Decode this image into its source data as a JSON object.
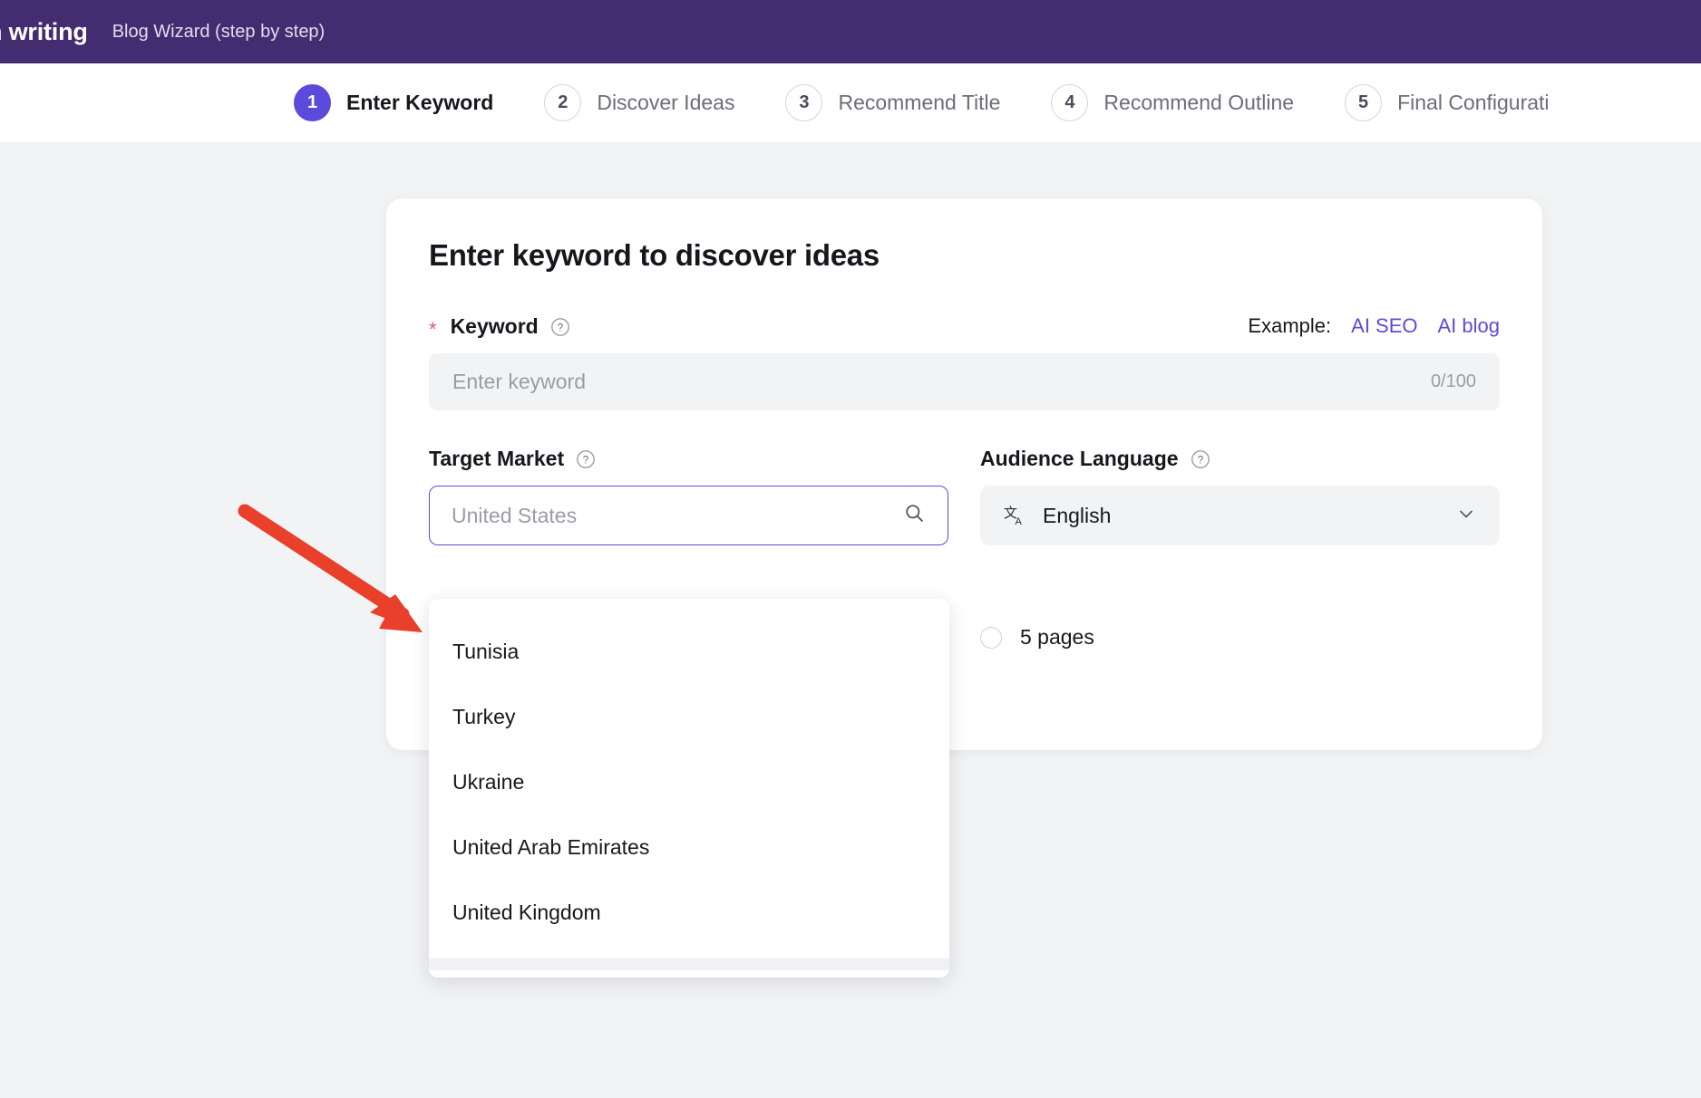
{
  "appbar": {
    "brand": "n writing",
    "subtitle": "Blog Wizard (step by step)",
    "bg_color": "#432c70"
  },
  "stepper": {
    "active_index": 0,
    "active_color": "#5b4bdd",
    "steps": [
      {
        "num": "1",
        "label": "Enter Keyword"
      },
      {
        "num": "2",
        "label": "Discover Ideas"
      },
      {
        "num": "3",
        "label": "Recommend Title"
      },
      {
        "num": "4",
        "label": "Recommend Outline"
      },
      {
        "num": "5",
        "label": "Final Configurati"
      }
    ]
  },
  "card": {
    "title": "Enter keyword to discover ideas",
    "keyword": {
      "label": "Keyword",
      "required_mark": "*",
      "help_icon": "question-circle-icon",
      "example_label": "Example:",
      "example_links": [
        "AI SEO",
        "AI blog"
      ],
      "placeholder": "Enter keyword",
      "value": "",
      "counter": "0/100",
      "link_color": "#5b4bdd"
    },
    "target_market": {
      "label": "Target Market",
      "help_icon": "question-circle-icon",
      "placeholder": "United States",
      "value": "",
      "search_icon": "search-icon",
      "focused": true,
      "focus_color": "#5b4bdd"
    },
    "audience_language": {
      "label": "Audience Language",
      "help_icon": "question-circle-icon",
      "icon": "translate-icon",
      "value": "English",
      "chevron_icon": "chevron-down-icon"
    },
    "pages_option": {
      "label": "5 pages",
      "selected": false
    }
  },
  "dropdown": {
    "items": [
      "Tunisia",
      "Turkey",
      "Ukraine",
      "United Arab Emirates",
      "United Kingdom"
    ]
  },
  "annotation": {
    "arrow_color": "#e8402a",
    "points_to": "target-market-dropdown"
  }
}
